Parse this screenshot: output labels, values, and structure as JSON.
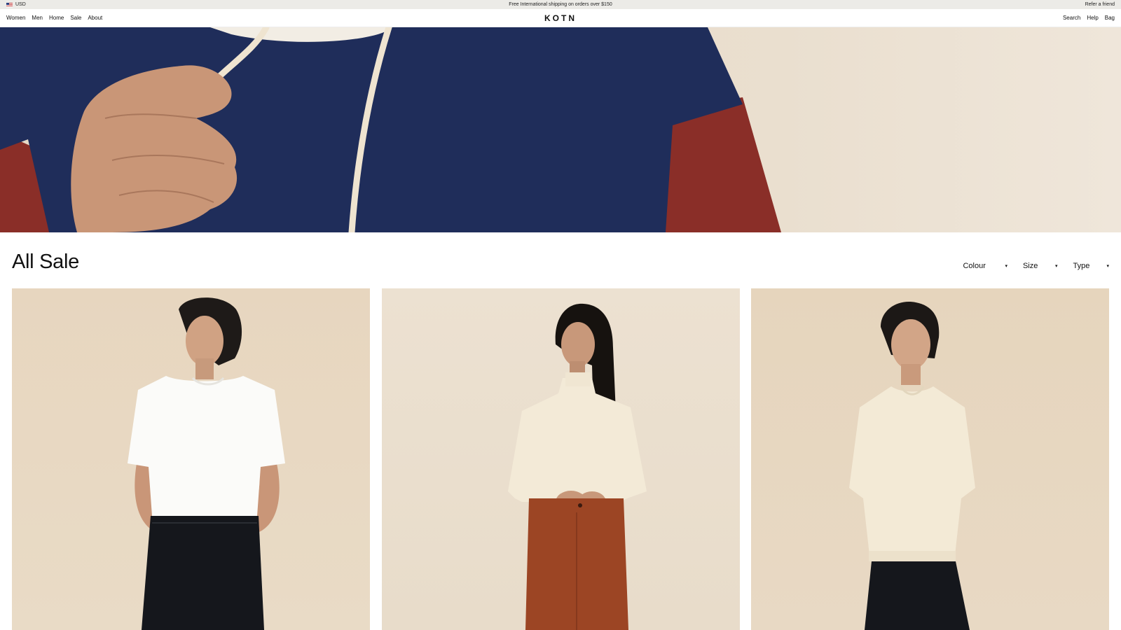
{
  "announcement": {
    "currency": "USD",
    "promo": "Free International shipping on orders over $150",
    "refer": "Refer a friend"
  },
  "nav": {
    "left": [
      "Women",
      "Men",
      "Home",
      "Sale",
      "About"
    ],
    "logo": "KOTN",
    "right": [
      "Search",
      "Help",
      "Bag"
    ]
  },
  "page": {
    "title": "All Sale"
  },
  "filters": [
    {
      "label": "Colour",
      "icon": "caret-down-icon"
    },
    {
      "label": "Size",
      "icon": "caret-down-icon"
    },
    {
      "label": "Type",
      "icon": "caret-down-icon"
    }
  ],
  "products": [
    {
      "image": "man-white-tee-black-pants"
    },
    {
      "image": "woman-cream-mockneck-rust-pants"
    },
    {
      "image": "man-cream-sweatshirt"
    }
  ],
  "colors": {
    "announcement_bg": "#ecebe7",
    "hero_navy": "#1f2d5a",
    "hero_red": "#8a2e28",
    "background_beige": "#e8dac6"
  }
}
